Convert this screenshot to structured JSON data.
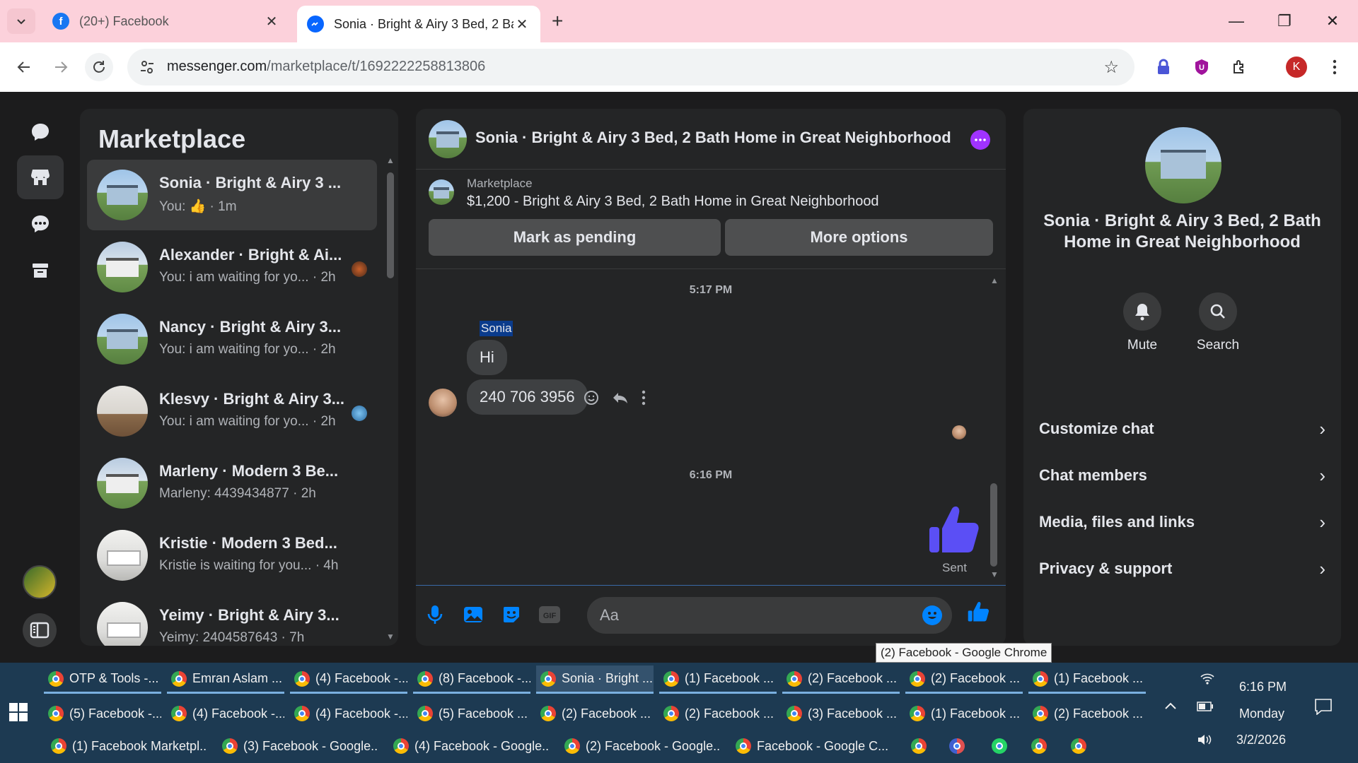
{
  "browser": {
    "tabs": [
      {
        "title": "(20+) Facebook",
        "favicon": "facebook-icon",
        "active": false
      },
      {
        "title": "Sonia · Bright & Airy 3 Bed, 2 Ba",
        "favicon": "messenger-icon",
        "active": true
      }
    ],
    "url_host": "messenger.com",
    "url_path": "/marketplace/t/1692222258813806",
    "profile_initial": "K",
    "tooltip": "(2) Facebook - Google Chrome"
  },
  "sidebar": {
    "title": "Marketplace",
    "conversations": [
      {
        "name": "Sonia · Bright & Airy 3 ...",
        "preview": "You: 👍 · 1m",
        "thumb": "blue"
      },
      {
        "name": "Alexander · Bright & Ai...",
        "preview": "You: i am waiting for yo... · 2h",
        "thumb": "white"
      },
      {
        "name": "Nancy · Bright & Airy 3...",
        "preview": "You: i am waiting for yo... · 2h",
        "thumb": "blue"
      },
      {
        "name": "Klesvy · Bright & Airy 3...",
        "preview": "You: i am waiting for yo... · 2h",
        "thumb": "interior"
      },
      {
        "name": "Marleny · Modern 3 Be...",
        "preview": "Marleny: 4439434877 · 2h",
        "thumb": "white"
      },
      {
        "name": "Kristie · Modern 3 Bed...",
        "preview": "Kristie is waiting for you... · 4h",
        "thumb": "kitchen"
      },
      {
        "name": "Yeimy · Bright & Airy 3...",
        "preview": "Yeimy: 2404587643 · 7h",
        "thumb": "kitchen"
      }
    ]
  },
  "chat": {
    "title": "Sonia · Bright & Airy 3 Bed, 2 Bath Home in Great Neighborhood",
    "listing_label": "Marketplace",
    "listing_price": "$1,200 - Bright & Airy 3 Bed, 2 Bath Home in Great Neighborhood",
    "mark_pending": "Mark as pending",
    "more_options": "More options",
    "time1": "5:17 PM",
    "sender": "Sonia",
    "msg1": "Hi",
    "msg2": "240 706 3956",
    "time2": "6:16 PM",
    "sent_label": "Sent",
    "composer_placeholder": "Aa"
  },
  "info": {
    "name": "Sonia · Bright & Airy 3 Bed, 2 Bath Home in Great Neighborhood",
    "mute": "Mute",
    "search": "Search",
    "rows": [
      "Customize chat",
      "Chat members",
      "Media, files and links",
      "Privacy & support"
    ]
  },
  "colors": {
    "accent": "#0084ff",
    "more_dot": "#a033ff",
    "tab_strip": "#fcd1db"
  },
  "taskbar": {
    "row1": [
      "OTP & Tools -...",
      "Emran Aslam ...",
      "(4) Facebook -...",
      "(8) Facebook -...",
      "Sonia · Bright ...",
      "(1) Facebook ...",
      "(2) Facebook ...",
      "(2) Facebook ...",
      "(1) Facebook ..."
    ],
    "row2": [
      "(5) Facebook -...",
      "(4) Facebook -...",
      "(4) Facebook -...",
      "(5) Facebook ...",
      "(2) Facebook ...",
      "(2) Facebook ...",
      "(3) Facebook ...",
      "(1) Facebook ...",
      "(2) Facebook ..."
    ],
    "row3": [
      "(1) Facebook Marketpl...",
      "(3) Facebook - Google...",
      "(4) Facebook - Google...",
      "(2) Facebook - Google...",
      "Facebook - Google C..."
    ],
    "time": "6:16 PM",
    "day": "Monday",
    "date": "3/2/2026"
  }
}
